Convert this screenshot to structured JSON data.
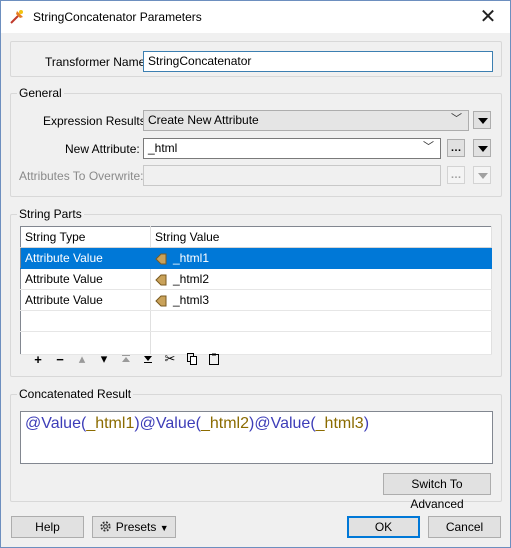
{
  "window": {
    "title": "StringConcatenator Parameters"
  },
  "transformer_name": {
    "label": "Transformer Name:",
    "value": "StringConcatenator"
  },
  "general": {
    "title": "General",
    "expression_results": {
      "label": "Expression Results:",
      "value": "Create New Attribute"
    },
    "new_attribute": {
      "label": "New Attribute:",
      "value": "_html"
    },
    "attributes_to_overwrite": {
      "label": "Attributes To Overwrite:",
      "value": ""
    }
  },
  "string_parts": {
    "title": "String Parts",
    "columns": [
      "String Type",
      "String Value"
    ],
    "rows": [
      {
        "type": "Attribute Value",
        "value": "_html1",
        "selected": true
      },
      {
        "type": "Attribute Value",
        "value": "_html2",
        "selected": false
      },
      {
        "type": "Attribute Value",
        "value": "_html3",
        "selected": false
      }
    ],
    "toolbar_icons": [
      "add-icon",
      "remove-icon",
      "move-up-icon",
      "move-down-icon",
      "move-to-top-icon",
      "move-to-bottom-icon",
      "cut-icon",
      "copy-icon",
      "paste-icon"
    ]
  },
  "concatenated_result": {
    "title": "Concatenated Result",
    "parts": [
      {
        "fn": "@Value(",
        "attr": "_html1",
        "close": ")"
      },
      {
        "fn": "@Value(",
        "attr": "_html2",
        "close": ")"
      },
      {
        "fn": "@Value(",
        "attr": "_html3",
        "close": ")"
      }
    ],
    "switch_label": "Switch To Advanced"
  },
  "footer": {
    "help": "Help",
    "presets": "Presets",
    "ok": "OK",
    "cancel": "Cancel"
  },
  "colors": {
    "selection": "#0078d7",
    "function_text": "#3d3db8",
    "attribute_text": "#8b6b00"
  }
}
